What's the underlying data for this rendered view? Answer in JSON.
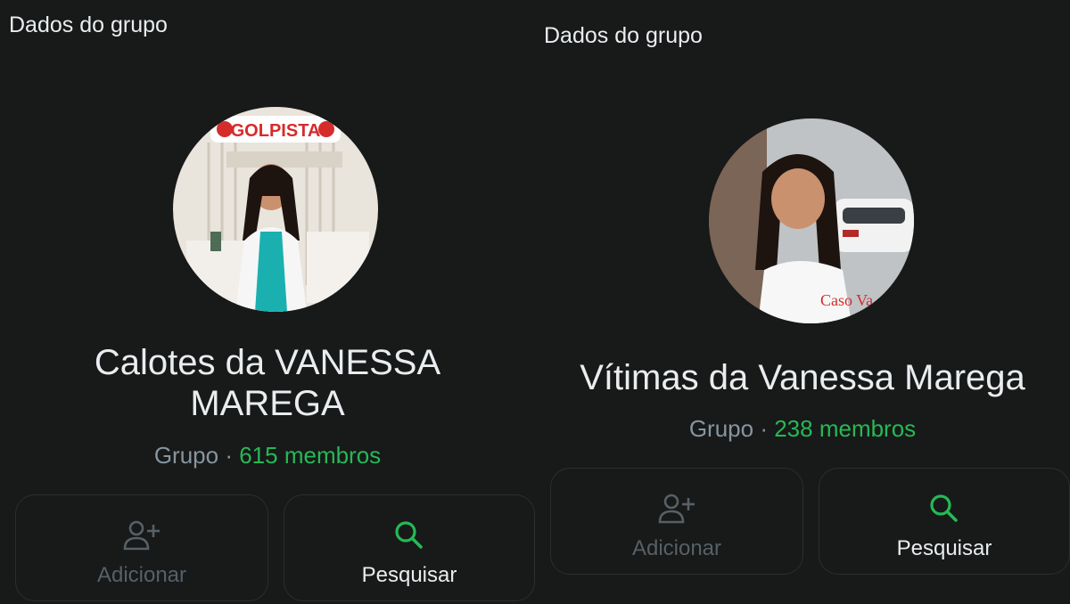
{
  "left": {
    "header_title": "Dados do grupo",
    "avatar_badge": "GOLPISTA",
    "group_name_line1": "Calotes da VANESSA",
    "group_name_line2": "MAREGA",
    "group_type": "Grupo",
    "separator": "·",
    "members": "615 membros",
    "add_label": "Adicionar",
    "search_label": "Pesquisar"
  },
  "right": {
    "header_title": "Dados do grupo",
    "avatar_caption": "Caso Va",
    "group_name": "Vítimas da Vanessa Marega",
    "group_type": "Grupo",
    "separator": "·",
    "members": "238 membros",
    "add_label": "Adicionar",
    "search_label": "Pesquisar"
  },
  "colors": {
    "background": "#181919",
    "text": "#e9edef",
    "muted": "#8696a0",
    "accent_green": "#25b955",
    "disabled": "#566166",
    "badge_red": "#d62b2b"
  },
  "icons": {
    "add": "add-person-icon",
    "search": "search-icon"
  }
}
